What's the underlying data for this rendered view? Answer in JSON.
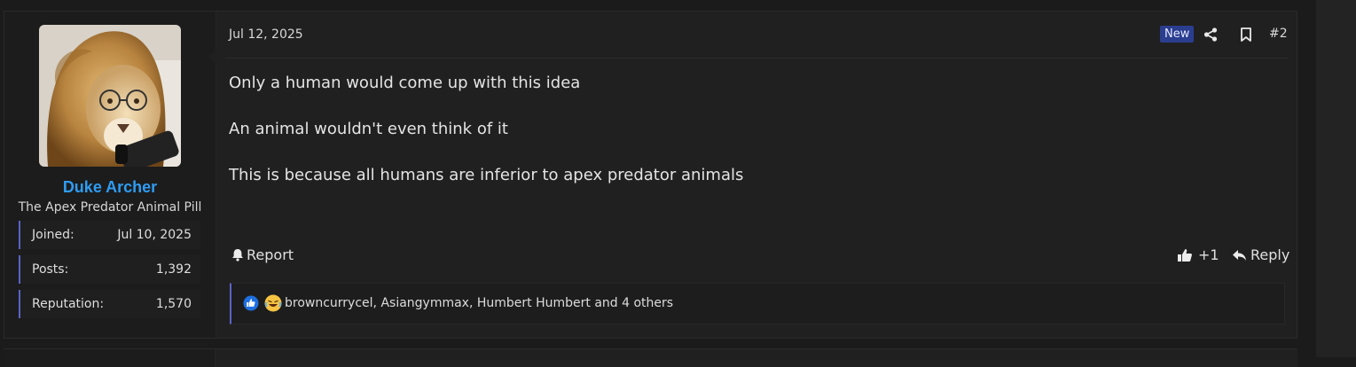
{
  "post": {
    "user": {
      "name": "Duke Archer",
      "title": "The Apex Predator Animal Pill",
      "stats": [
        {
          "label": "Joined:",
          "value": "Jul 10, 2025"
        },
        {
          "label": "Posts:",
          "value": "1,392"
        },
        {
          "label": "Reputation:",
          "value": "1,570"
        }
      ],
      "avatar_icon": "lion-with-glasses-avatar"
    },
    "date": "Jul 12, 2025",
    "badge": "New",
    "post_number": "#2",
    "body": [
      "Only a human would come up with this idea",
      "An animal wouldn't even think of it",
      "This is because all humans are inferior to apex predator animals"
    ],
    "actions": {
      "report_label": "Report",
      "like_count": "+1",
      "reply_label": "Reply"
    },
    "reactions_text": "browncurrycel, Asiangymmax, Humbert Humbert and 4 others"
  },
  "colors": {
    "accent": "#5b63c9",
    "username": "#2f9cf2",
    "badge": "#2a3d8f"
  }
}
